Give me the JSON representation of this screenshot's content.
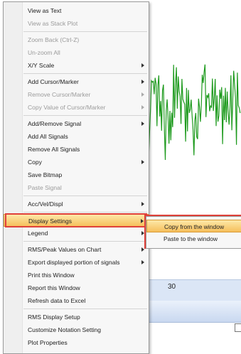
{
  "plot": {
    "signal_color": "#1d9a1d",
    "axis_tick": "30"
  },
  "menu": {
    "groups": [
      [
        {
          "label": "View as Text",
          "enabled": true,
          "submenu": false
        },
        {
          "label": "View as Stack Plot",
          "enabled": false,
          "submenu": false
        }
      ],
      [
        {
          "label": "Zoom Back (Ctrl-Z)",
          "enabled": false,
          "submenu": false
        },
        {
          "label": "Un-zoom All",
          "enabled": false,
          "submenu": false
        },
        {
          "label": "X/Y Scale",
          "enabled": true,
          "submenu": true
        }
      ],
      [
        {
          "label": "Add Cursor/Marker",
          "enabled": true,
          "submenu": true
        },
        {
          "label": "Remove Cursor/Marker",
          "enabled": false,
          "submenu": true
        },
        {
          "label": "Copy Value of Cursor/Marker",
          "enabled": false,
          "submenu": true
        }
      ],
      [
        {
          "label": "Add/Remove Signal",
          "enabled": true,
          "submenu": true
        },
        {
          "label": "Add All Signals",
          "enabled": true,
          "submenu": false
        },
        {
          "label": "Remove All Signals",
          "enabled": true,
          "submenu": false
        },
        {
          "label": "Copy",
          "enabled": true,
          "submenu": true
        },
        {
          "label": "Save Bitmap",
          "enabled": true,
          "submenu": false
        },
        {
          "label": "Paste Signal",
          "enabled": false,
          "submenu": false
        }
      ],
      [
        {
          "label": "Acc/Vel/Displ",
          "enabled": true,
          "submenu": true
        }
      ],
      [
        {
          "label": "Display Settings",
          "enabled": true,
          "submenu": true,
          "highlighted": true
        },
        {
          "label": "Legend",
          "enabled": true,
          "submenu": true
        }
      ],
      [
        {
          "label": "RMS/Peak Values on Chart",
          "enabled": true,
          "submenu": true
        },
        {
          "label": "Export displayed portion of signals",
          "enabled": true,
          "submenu": true
        },
        {
          "label": "Print this Window",
          "enabled": true,
          "submenu": false
        },
        {
          "label": "Report this Window",
          "enabled": true,
          "submenu": false
        },
        {
          "label": "Refresh data to Excel",
          "enabled": true,
          "submenu": false
        }
      ],
      [
        {
          "label": "RMS Display Setup",
          "enabled": true,
          "submenu": false
        },
        {
          "label": "Customize Notation Setting",
          "enabled": true,
          "submenu": false
        },
        {
          "label": "Plot Properties",
          "enabled": true,
          "submenu": false
        }
      ]
    ]
  },
  "submenu": {
    "items": [
      {
        "label": "Copy from the window",
        "highlighted": true
      },
      {
        "label": "Paste to the window",
        "highlighted": false
      }
    ]
  }
}
